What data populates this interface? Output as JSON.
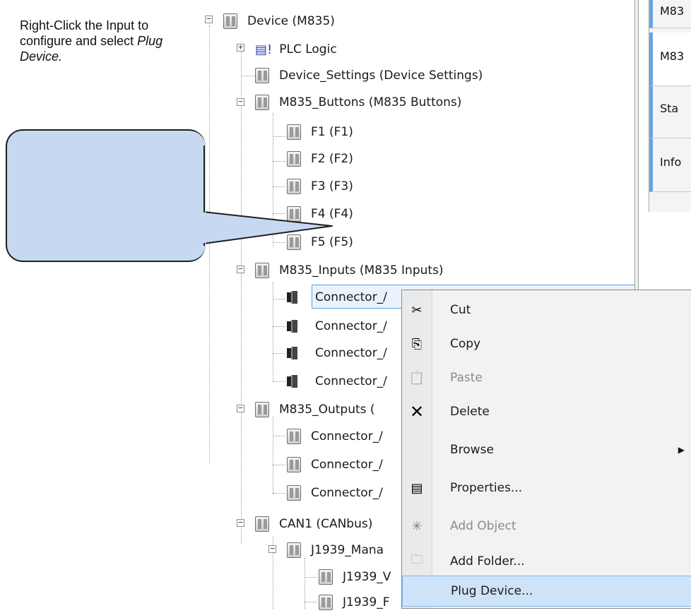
{
  "tree": {
    "items": [
      {
        "label": "Device (M835)"
      },
      {
        "label": "PLC Logic"
      },
      {
        "label": "Device_Settings (Device Settings)"
      },
      {
        "label": "M835_Buttons (M835 Buttons)"
      },
      {
        "label": "F1 (F1)"
      },
      {
        "label": "F2 (F2)"
      },
      {
        "label": "F3 (F3)"
      },
      {
        "label": "F4 (F4)"
      },
      {
        "label": "F5 (F5)"
      },
      {
        "label": "M835_Inputs (M835 Inputs)"
      },
      {
        "label": "Connector_/"
      },
      {
        "label": "Connector_/"
      },
      {
        "label": "Connector_/"
      },
      {
        "label": "Connector_/"
      },
      {
        "label": "M835_Outputs ("
      },
      {
        "label": "Connector_/"
      },
      {
        "label": "Connector_/"
      },
      {
        "label": "Connector_/"
      },
      {
        "label": "CAN1 (CANbus)"
      },
      {
        "label": "J1939_Mana"
      },
      {
        "label": "J1939_V"
      },
      {
        "label": "J1939_F"
      }
    ]
  },
  "right_panel": {
    "tabs": [
      {
        "label": "M83"
      },
      {
        "label": "M83"
      },
      {
        "label": "Sta"
      },
      {
        "label": "Info"
      }
    ]
  },
  "callout": {
    "line1": "Right-Click the Input to configure and select ",
    "italic": "Plug Device."
  },
  "context_menu": {
    "items": [
      {
        "label": "Cut",
        "icon": "scissors-icon"
      },
      {
        "label": "Copy",
        "icon": "copy-icon"
      },
      {
        "label": "Paste",
        "icon": "paste-icon"
      },
      {
        "label": "Delete",
        "icon": "delete-icon"
      },
      {
        "label": "Browse",
        "icon": "submenu-arrow-icon"
      },
      {
        "label": "Properties...",
        "icon": "properties-icon"
      },
      {
        "label": "Add Object",
        "icon": "add-object-icon"
      },
      {
        "label": "Add Folder...",
        "icon": "folder-icon"
      },
      {
        "label": "Plug Device...",
        "icon": ""
      }
    ]
  },
  "colors": {
    "callout_fill": "#c6d9f1",
    "selection": "#cfe3f8",
    "accent_tab": "#6aa4e0"
  }
}
